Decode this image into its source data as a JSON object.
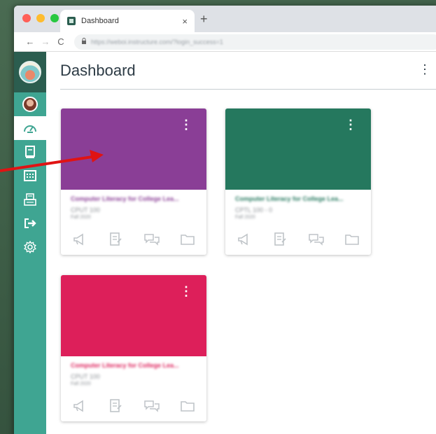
{
  "browser": {
    "tab_title": "Dashboard",
    "tab_close": "×",
    "new_tab": "+",
    "url": "https://weboi.instructure.com/?login_success=1",
    "back": "←",
    "forward": "→",
    "reload": "C"
  },
  "sidebar": {
    "items": [
      {
        "name": "account-avatar"
      },
      {
        "name": "dashboard-icon"
      },
      {
        "name": "courses-icon"
      },
      {
        "name": "calendar-icon"
      },
      {
        "name": "inbox-icon"
      },
      {
        "name": "logout-icon"
      },
      {
        "name": "settings-icon"
      }
    ],
    "colors": {
      "bar": "#3fa592",
      "logo_bg": "#2b5d4f"
    }
  },
  "page": {
    "title": "Dashboard",
    "menu_glyph": "⋮"
  },
  "cards": [
    {
      "name": "Computer Literacy for College Lea...",
      "code": "CPUT 100",
      "term": "Fall 2020",
      "color": "#8a3e96",
      "kebab": "⋮"
    },
    {
      "name": "Computer Literacy for College Lea...",
      "code": "CPTL 100 - 0",
      "term": "Fall 2020",
      "color": "#25785e",
      "kebab": "⋮"
    },
    {
      "name": "Computer Literacy for College Lea...",
      "code": "CPUT 100",
      "term": "Fall 2020",
      "color": "#dd1f5a",
      "kebab": "⋮"
    }
  ],
  "annotation": {
    "arrow_color": "#e01313"
  }
}
